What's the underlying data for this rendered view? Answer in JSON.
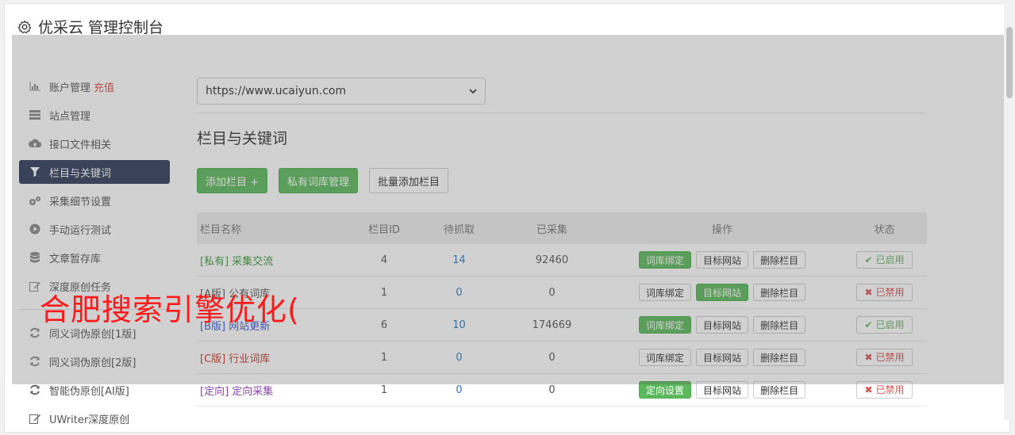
{
  "header": {
    "title": "优采云 管理控制台"
  },
  "sidebar": {
    "items": [
      {
        "label": "账户管理",
        "extra": "充值",
        "icon": "bar-chart-icon"
      },
      {
        "label": "站点管理",
        "icon": "server-icon"
      },
      {
        "label": "接口文件相关",
        "icon": "cloud-upload-icon"
      },
      {
        "label": "栏目与关键词",
        "icon": "filter-icon",
        "active": true
      },
      {
        "label": "采集细节设置",
        "icon": "gears-icon"
      },
      {
        "label": "手动运行测试",
        "icon": "play-circle-icon"
      },
      {
        "label": "文章暂存库",
        "icon": "database-icon"
      },
      {
        "label": "深度原创任务",
        "icon": "edit-icon"
      }
    ],
    "items2": [
      {
        "label": "同义词伪原创[1版]",
        "icon": "refresh-icon"
      },
      {
        "label": "同义词伪原创[2版]",
        "icon": "refresh-icon"
      },
      {
        "label": "智能伪原创[AI版]",
        "icon": "refresh-icon"
      },
      {
        "label": "UWriter深度原创",
        "icon": "edit-icon"
      }
    ]
  },
  "main": {
    "site_select": {
      "value": "https://www.ucaiyun.com"
    },
    "section_title": "栏目与关键词",
    "buttons": {
      "add_column": "添加栏目 +",
      "private_lib": "私有词库管理",
      "batch_add": "批量添加栏目"
    },
    "table": {
      "headers": [
        "栏目名称",
        "栏目ID",
        "待抓取",
        "已采集",
        "操作",
        "状态"
      ],
      "rows": [
        {
          "prefix": "[私有]",
          "name": "采集交流",
          "color": "#3c9b3c",
          "id": "4",
          "pending": "14",
          "collected": "92460",
          "ops": [
            "词库绑定",
            "目标网站",
            "删除栏目"
          ],
          "highlight": 0,
          "status": "已启用",
          "enabled": true
        },
        {
          "prefix": "[A版]",
          "name": "公有词库",
          "color": "#555555",
          "id": "1",
          "pending": "0",
          "collected": "0",
          "ops": [
            "词库绑定",
            "目标网站",
            "删除栏目"
          ],
          "highlight": 1,
          "status": "已禁用",
          "enabled": false
        },
        {
          "prefix": "[B版]",
          "name": "网站更新",
          "color": "#3b5bd9",
          "id": "6",
          "pending": "10",
          "collected": "174669",
          "ops": [
            "词库绑定",
            "目标网站",
            "删除栏目"
          ],
          "highlight": 0,
          "status": "已启用",
          "enabled": true
        },
        {
          "prefix": "[C版]",
          "name": "行业词库",
          "color": "#c0392b",
          "id": "1",
          "pending": "0",
          "collected": "0",
          "ops": [
            "词库绑定",
            "目标网站",
            "删除栏目"
          ],
          "highlight": -1,
          "status": "已禁用",
          "enabled": false
        },
        {
          "prefix": "[定向]",
          "name": "定向采集",
          "color": "#8e44ad",
          "id": "1",
          "pending": "0",
          "collected": "0",
          "ops": [
            "定向设置",
            "目标网站",
            "删除栏目"
          ],
          "highlight": 0,
          "status": "已禁用",
          "enabled": false
        }
      ]
    }
  },
  "watermark": {
    "text": "合肥搜索引擎优化("
  },
  "colors": {
    "accent": "#5cb85c",
    "danger": "#d9534f",
    "nav_active": "#2d3a58",
    "link": "#337ab7"
  }
}
